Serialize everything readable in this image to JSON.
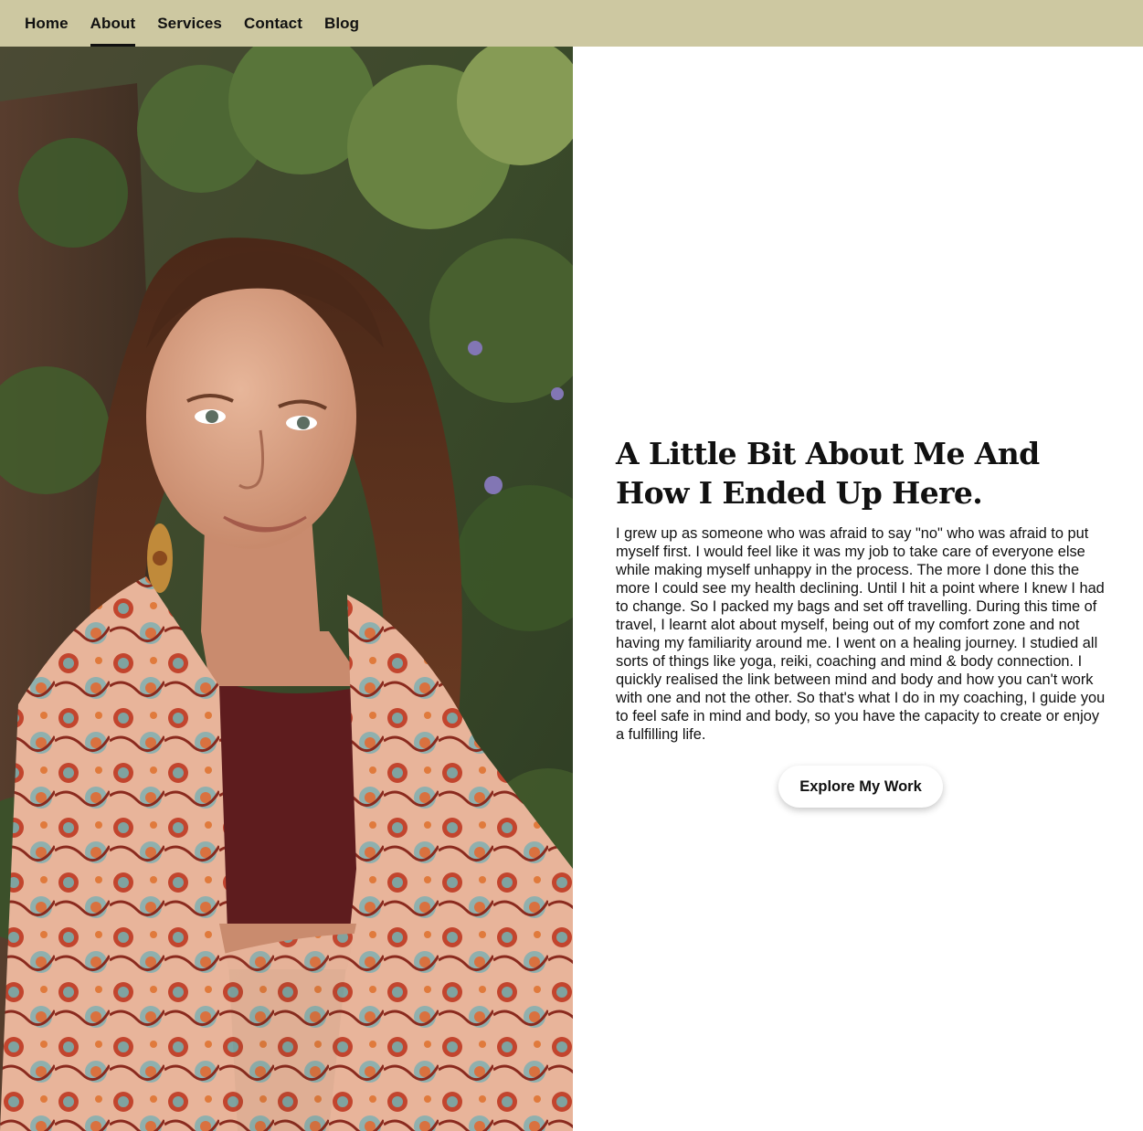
{
  "nav": {
    "items": [
      {
        "label": "Home",
        "active": false
      },
      {
        "label": "About",
        "active": true
      },
      {
        "label": "Services",
        "active": false
      },
      {
        "label": "Contact",
        "active": false
      },
      {
        "label": "Blog",
        "active": false
      }
    ]
  },
  "about": {
    "title": "A Little Bit About Me And How I Ended Up Here.",
    "body": "I grew up as someone who was afraid to say \"no\" who was afraid to put myself first. I would feel like it was my job to take care of everyone else while making myself unhappy in the process. The more I done this the more I could see my health declining. Until I hit a point where I knew I had to change. So I packed my bags and set off travelling. During this time of travel, I learnt alot about myself, being out of my comfort zone and not having my familiarity around me. I went on a healing journey. I studied all sorts of things like yoga, reiki, coaching and mind & body connection. I quickly realised the link between mind and body and how you can't work with one and not the other. So that's what I do in my coaching, I guide you to feel safe in mind and body, so you have the capacity to create or enjoy a fulfilling life.",
    "button_label": "Explore My Work"
  },
  "colors": {
    "nav_background": "#cdc8a1",
    "text": "#111111",
    "page_background": "#ffffff"
  }
}
